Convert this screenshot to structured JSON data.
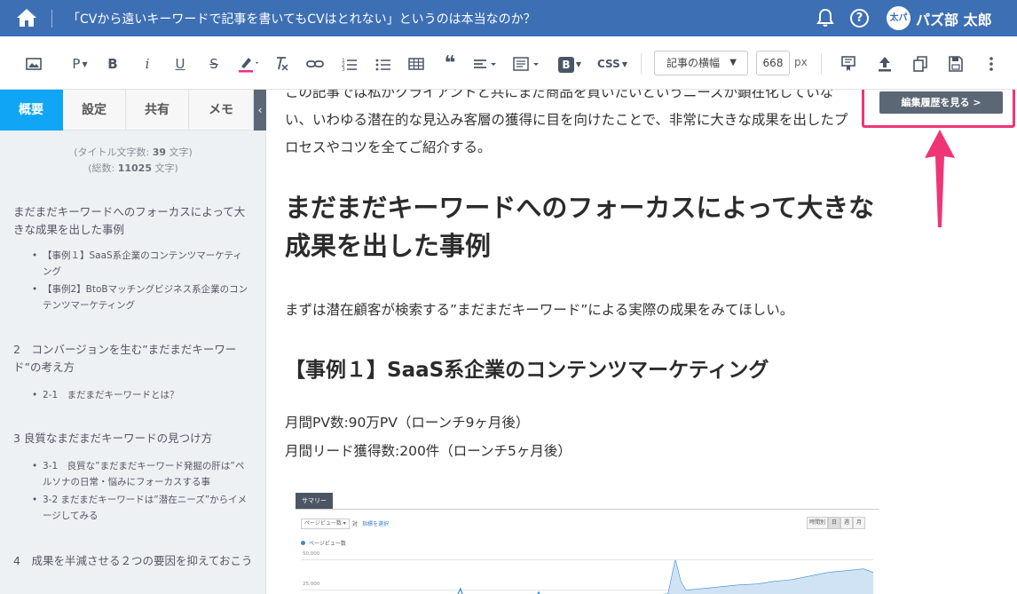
{
  "topbar": {
    "document_title": "「CVから遠いキーワードで記事を書いてもCVはとれない」というのは本当なのか？",
    "help_label": "?",
    "user": {
      "avatar_text": "太パ",
      "name": "パズ部 太郎"
    },
    "icons": [
      "home-icon",
      "bell-icon",
      "help-icon"
    ]
  },
  "toolbar": {
    "paragraph_label": "P",
    "bold_label": "B",
    "italic_label": "i",
    "underline_label": "U",
    "strike_label": "S",
    "quote_label": "❝",
    "block_label": "B",
    "css_label": "CSS",
    "width_select": "記事の横幅",
    "width_value": "668",
    "width_unit": "px",
    "highlight_color": "#e8308a"
  },
  "sidebar": {
    "tabs": [
      "概要",
      "設定",
      "共有",
      "メモ"
    ],
    "active_tab": "概要",
    "title_count": {
      "prefix": "(タイトル文字数: ",
      "value": "39",
      "suffix": " 文字)"
    },
    "total_count": {
      "prefix": "(総数: ",
      "value": "11025",
      "suffix": " 文字)"
    },
    "toc": [
      {
        "title": "まだまだキーワードへのフォーカスによって大きな成果を出した事例",
        "items": [
          "【事例１】SaaS系企業のコンテンツマーケティング",
          "【事例2】BtoBマッチングビジネス系企業のコンテンツマーケティング"
        ]
      },
      {
        "title": "2　コンバージョンを生む”まだまだキーワード”の考え方",
        "items": [
          "2-1　まだまだキーワードとは？"
        ]
      },
      {
        "title": "3 良質なまだまだキーワードの見つけ方",
        "items": [
          "3-1　良質な”まだまだキーワード発掘の肝は”ペルソナの日常・悩みにフォーカスする事",
          "3-2 まだまだキーワードは”潜在ニーズ”からイメージしてみる"
        ]
      },
      {
        "title": "4　成果を半減させる２つの要因を抑えておこう",
        "items": []
      }
    ]
  },
  "content": {
    "intro_line1": "この記事では私がクライアントと共にまだ商品を買いたいというニーズが顕在化していな",
    "intro_line2": "い、いわゆる潜在的な見込み客層の獲得に目を向けたことで、非常に大きな成果を出したプ",
    "intro_line3": "ロセスやコツを全てご紹介する。",
    "heading": "まだまだキーワードへのフォーカスによって大きな成果を出した事例",
    "lead": "まずは潜在顧客が検索する”まだまだキーワード”による実際の成果をみてほしい。",
    "subheading": "【事例１】SaaS系企業のコンテンツマーケティング",
    "stat1": "月間PV数:90万PV（ローンチ9ヶ月後）",
    "stat2": "月間リード獲得数:200件（ローンチ5ヶ月後）",
    "history_button": "編集履歴を見る >",
    "highlight_color": "#f03577"
  },
  "embedded_screenshot": {
    "tab": "サマリー",
    "metric_select": "ページビュー数 ▾",
    "vs_label": "対",
    "select_metric": "指標を選択",
    "segments": [
      "時間別",
      "日",
      "週",
      "月"
    ],
    "active_segment": "日",
    "legend": "ページビュー数",
    "y_labels": [
      "50,000",
      "25,000"
    ],
    "line_color": "#3b8bd0"
  }
}
